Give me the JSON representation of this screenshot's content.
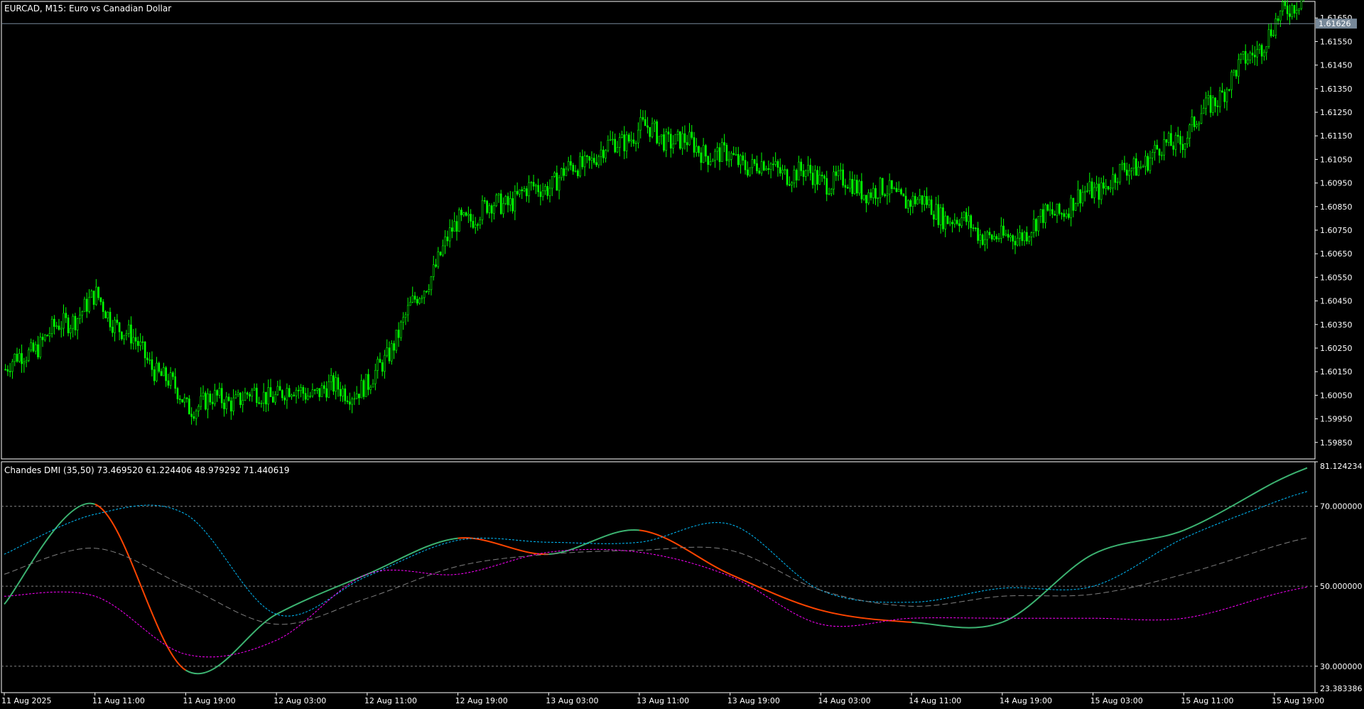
{
  "main_panel": {
    "title": "EURCAD, M15:  Euro vs Canadian Dollar",
    "current_price": "1.61626",
    "price_axis_labels": [
      "1.61650",
      "1.61550",
      "1.61450",
      "1.61350",
      "1.61250",
      "1.61150",
      "1.61050",
      "1.60950",
      "1.60850",
      "1.60750",
      "1.60650",
      "1.60550",
      "1.60450",
      "1.60350",
      "1.60250",
      "1.60150",
      "1.60050",
      "1.59950",
      "1.59850"
    ]
  },
  "indicator_panel": {
    "title": "Chandes DMI (35,50) 73.469520 61.224406 48.979292 71.440619",
    "axis_labels": [
      "81.124234",
      "70.000000",
      "50.000000",
      "30.000000",
      "23.383386"
    ]
  },
  "time_axis_labels": [
    "11 Aug 2025",
    "11 Aug 11:00",
    "11 Aug 19:00",
    "12 Aug 03:00",
    "12 Aug 11:00",
    "12 Aug 19:00",
    "13 Aug 03:00",
    "13 Aug 11:00",
    "13 Aug 19:00",
    "14 Aug 03:00",
    "14 Aug 11:00",
    "14 Aug 19:00",
    "15 Aug 03:00",
    "15 Aug 11:00",
    "15 Aug 19:00"
  ],
  "colors": {
    "background": "#000000",
    "frame": "#ffffff",
    "candle": "#00ff00",
    "current_price_line": "#778899",
    "current_price_tag": "#778899",
    "dmi_up": "#3cb371",
    "dmi_down": "#ff4500",
    "upper_band": "#00bfff",
    "lower_band": "#ff00ff",
    "middle_band": "#808080",
    "level_line": "#808080"
  },
  "chart_data": [
    {
      "type": "candlestick",
      "symbol": "EURCAD",
      "timeframe": "M15",
      "ylim": [
        1.5978,
        1.6172
      ],
      "price_at_11_Aug_2025": 1.6016,
      "price_path_by_time_axis_label": [
        1.6016,
        1.6046,
        1.6001,
        1.6006,
        1.6008,
        1.6079,
        1.6095,
        1.6118,
        1.6105,
        1.6097,
        1.6088,
        1.607,
        1.6092,
        1.6115,
        1.6162
      ],
      "high_at_15_Aug_19_00": 1.6168,
      "low_at_11_Aug_19_00": 1.5986,
      "current_price": 1.61626
    },
    {
      "type": "line",
      "indicator": "Chandes DMI (35,50)",
      "ylim": [
        23.383386,
        81.124234
      ],
      "levels": [
        30,
        50,
        70
      ],
      "indicator_values": [
        73.46952,
        61.224406,
        48.979292,
        71.440619
      ],
      "x": [
        "11 Aug 2025",
        "11 Aug 11:00",
        "11 Aug 19:00",
        "12 Aug 03:00",
        "12 Aug 11:00",
        "12 Aug 19:00",
        "13 Aug 03:00",
        "13 Aug 11:00",
        "13 Aug 19:00",
        "14 Aug 03:00",
        "14 Aug 11:00",
        "14 Aug 19:00",
        "15 Aug 03:00",
        "15 Aug 11:00",
        "15 Aug 19:00"
      ],
      "series": [
        {
          "role": "dmi",
          "values": [
            45.5,
            70.5,
            29.0,
            43.0,
            53.0,
            62.0,
            58.0,
            64.0,
            53.0,
            44.0,
            41.0,
            41.0,
            58.0,
            64.0,
            76.0
          ]
        },
        {
          "role": "upper_band",
          "values": [
            58.0,
            68.0,
            68.0,
            43.0,
            52.5,
            61.5,
            61.0,
            61.0,
            65.5,
            49.0,
            46.0,
            49.5,
            50.0,
            62.0,
            71.0
          ]
        },
        {
          "role": "middle_band",
          "values": [
            53.0,
            59.5,
            50.0,
            40.5,
            47.0,
            55.0,
            58.0,
            59.0,
            59.0,
            49.0,
            45.0,
            47.5,
            48.0,
            53.0,
            60.0
          ]
        },
        {
          "role": "lower_band",
          "values": [
            47.5,
            47.5,
            33.0,
            36.5,
            53.0,
            53.0,
            58.5,
            58.5,
            52.5,
            40.5,
            42.0,
            42.0,
            42.0,
            42.0,
            48.0
          ]
        }
      ]
    }
  ]
}
